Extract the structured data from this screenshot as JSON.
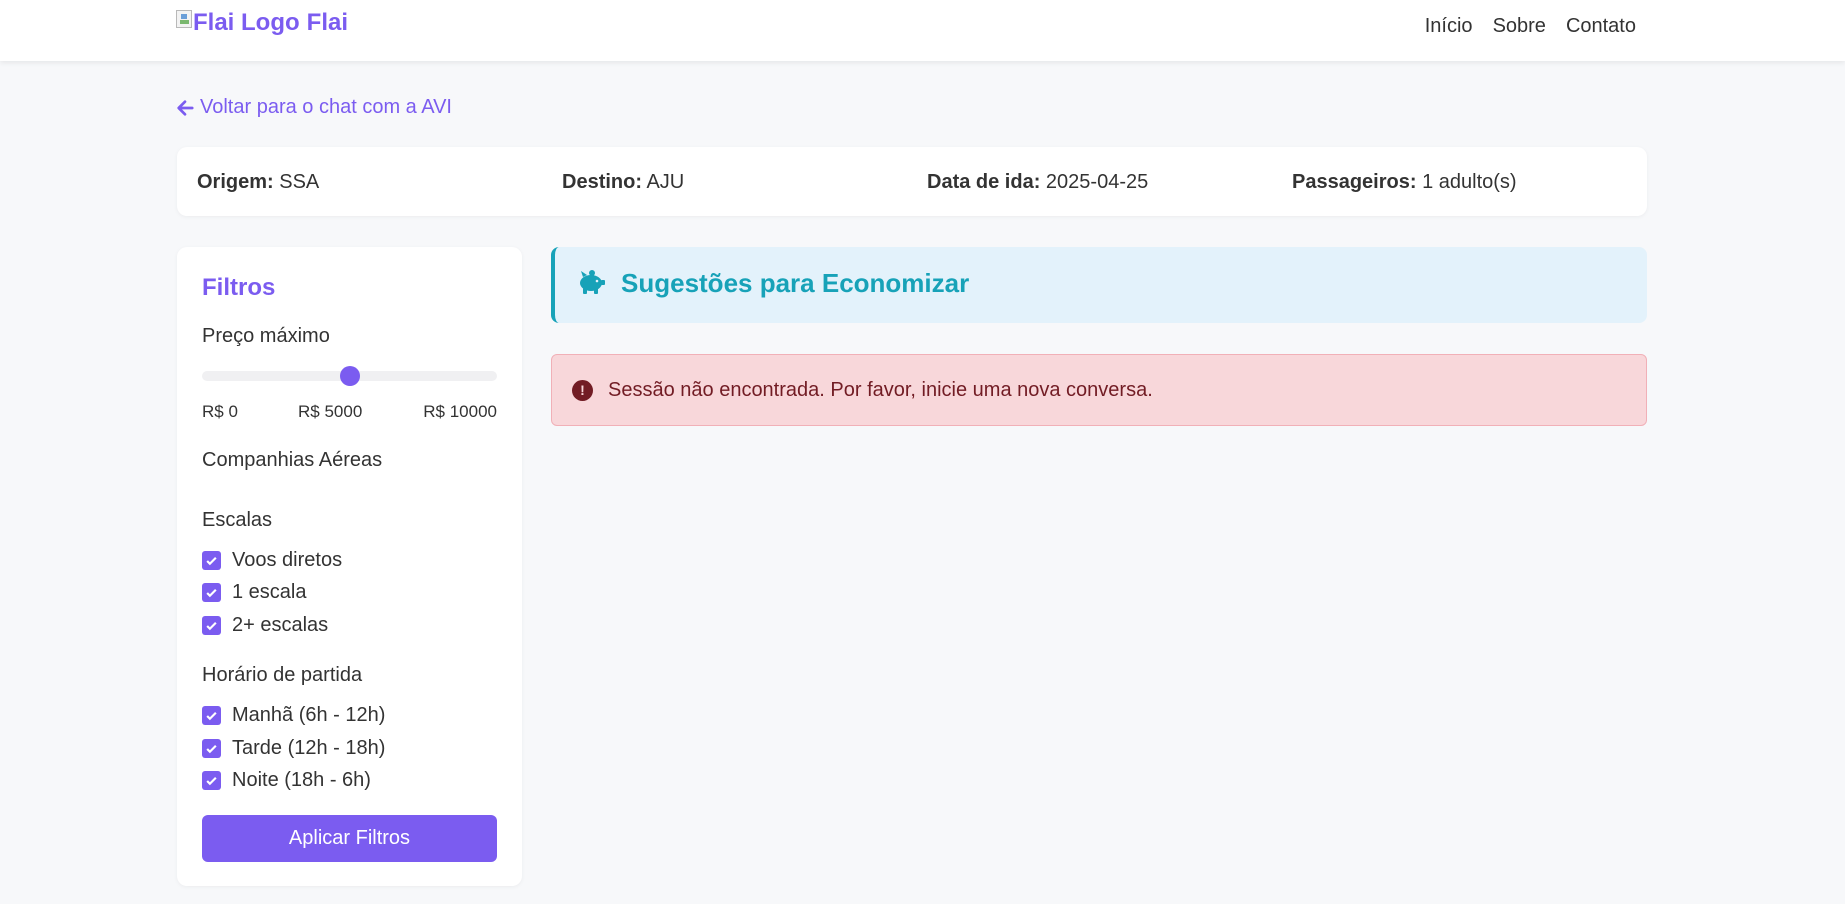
{
  "header": {
    "logo_alt": "Flai Logo",
    "brand_name": "Flai",
    "nav": [
      "Início",
      "Sobre",
      "Contato"
    ]
  },
  "back_link": "Voltar para o chat com a AVI",
  "search_summary": {
    "origin_label": "Origem:",
    "origin_value": "SSA",
    "destination_label": "Destino:",
    "destination_value": "AJU",
    "date_label": "Data de ida:",
    "date_value": "2025-04-25",
    "passengers_label": "Passageiros:",
    "passengers_value": "1 adulto(s)"
  },
  "filters": {
    "title": "Filtros",
    "max_price_label": "Preço máximo",
    "price_min_label": "R$ 0",
    "price_mid_label": "R$ 5000",
    "price_max_label": "R$ 10000",
    "price_value_fraction": 0.5,
    "airlines_label": "Companhias Aéreas",
    "stops_label": "Escalas",
    "stops_options": [
      "Voos diretos",
      "1 escala",
      "2+ escalas"
    ],
    "departure_label": "Horário de partida",
    "departure_options": [
      "Manhã (6h - 12h)",
      "Tarde (12h - 18h)",
      "Noite (18h - 6h)"
    ],
    "apply_button": "Aplicar Filtros"
  },
  "suggestions": {
    "title": "Sugestões para Economizar",
    "icon": "piggy-bank-icon"
  },
  "alert": {
    "message": "Sessão não encontrada. Por favor, inicie uma nova conversa.",
    "icon": "exclamation-circle-icon"
  },
  "colors": {
    "primary": "#7b5cf0",
    "info": "#17a2b8",
    "info_bg": "#e3f2fb",
    "danger_text": "#721c24",
    "danger_bg": "#f8d7da"
  }
}
